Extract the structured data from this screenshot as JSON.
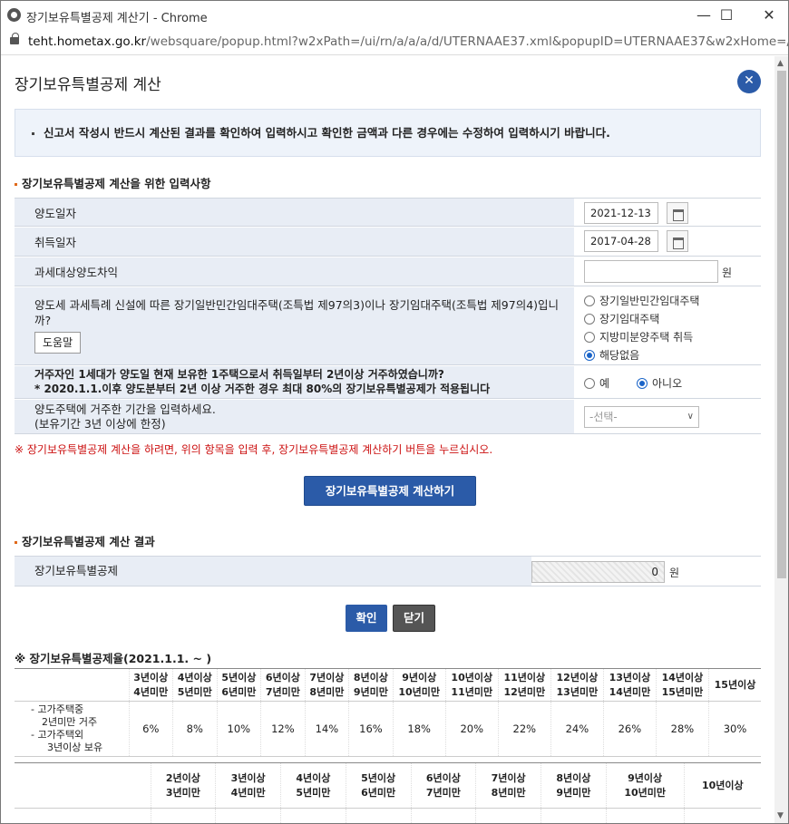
{
  "window": {
    "title": "장기보유특별공제 계산기 - Chrome",
    "url_domain": "teht.hometax.go.kr",
    "url_rest": "/websquare/popup.html?w2xPath=/ui/rn/a/a/a/d/UTERNAAE37.xml&popupID=UTERNAAE37&w2xHome=/ui..."
  },
  "page": {
    "title": "장기보유특별공제 계산",
    "notice": "신고서 작성시 반드시 계산된 결과를 확인하여 입력하시고 확인한 금액과 다른 경우에는 수정하여 입력하시기 바랍니다."
  },
  "input_section": {
    "title": "장기보유특별공제 계산을 위한 입력사항",
    "transfer_date": {
      "label": "양도일자",
      "value": "2021-12-13"
    },
    "acquire_date": {
      "label": "취득일자",
      "value": "2017-04-28"
    },
    "gain": {
      "label": "과세대상양도차익",
      "unit": "원"
    },
    "rental": {
      "label": "양도세 과세특례 신설에 따른 장기일반민간임대주택(조특법 제97의3)이나 장기임대주택(조특법 제97의4)입니까?",
      "help": "도움말",
      "options": [
        "장기일반민간임대주택",
        "장기임대주택",
        "지방미분양주택 취득",
        "해당없음"
      ],
      "selected": "해당없음"
    },
    "residence": {
      "line1": "거주자인 1세대가 양도일 현재 보유한 1주택으로서 취득일부터 2년이상 거주하였습니까?",
      "line2": "* 2020.1.1.이후 양도분부터 2년 이상 거주한 경우 최대 80%의 장기보유특별공제가 적용됩니다",
      "yes": "예",
      "no": "아니오",
      "selected": "아니오"
    },
    "period": {
      "line1": "양도주택에 거주한 기간을 입력하세요.",
      "line2": "(보유기간 3년 이상에 한정)",
      "placeholder": "-선택-"
    },
    "warning": "※ 장기보유특별공제 계산을 하려면, 위의 항목을 입력 후, 장기보유특별공제 계산하기 버튼을 누르십시오.",
    "calc_button": "장기보유특별공제 계산하기"
  },
  "result_section": {
    "title": "장기보유특별공제 계산 결과",
    "label": "장기보유특별공제",
    "value": "0",
    "unit": "원",
    "ok": "확인",
    "close": "닫기"
  },
  "rate_table": {
    "title": "※ 장기보유특별공제율(2021.1.1. ~ )",
    "t1_headers": [
      [
        "3년이상",
        "4년미만"
      ],
      [
        "4년이상",
        "5년미만"
      ],
      [
        "5년이상",
        "6년미만"
      ],
      [
        "6년이상",
        "7년미만"
      ],
      [
        "7년이상",
        "8년미만"
      ],
      [
        "8년이상",
        "9년미만"
      ],
      [
        "9년이상",
        "10년미만"
      ],
      [
        "10년이상",
        "11년미만"
      ],
      [
        "11년이상",
        "12년미만"
      ],
      [
        "12년이상",
        "13년미만"
      ],
      [
        "13년이상",
        "14년미만"
      ],
      [
        "14년이상",
        "15년미만"
      ],
      [
        "15년이상",
        ""
      ]
    ],
    "t1_row_label": [
      "- 고가주택중",
      "2년미만 거주",
      "- 고가주택외",
      "3년이상 보유"
    ],
    "t1_values": [
      "6%",
      "8%",
      "10%",
      "12%",
      "14%",
      "16%",
      "18%",
      "20%",
      "22%",
      "24%",
      "26%",
      "28%",
      "30%"
    ],
    "t2_headers": [
      [
        "2년이상",
        "3년미만"
      ],
      [
        "3년이상",
        "4년미만"
      ],
      [
        "4년이상",
        "5년미만"
      ],
      [
        "5년이상",
        "6년미만"
      ],
      [
        "6년이상",
        "7년미만"
      ],
      [
        "7년이상",
        "8년미만"
      ],
      [
        "8년이상",
        "9년미만"
      ],
      [
        "9년이상",
        "10년미만"
      ],
      [
        "10년이상",
        ""
      ]
    ]
  }
}
